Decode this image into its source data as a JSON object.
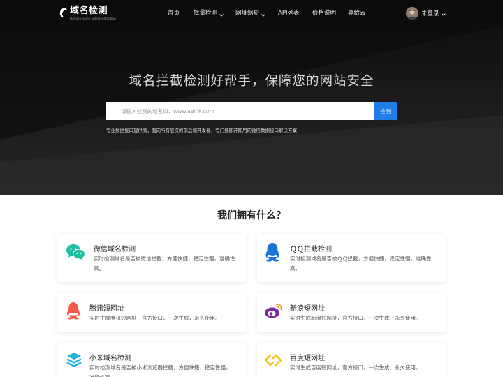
{
  "nav": {
    "logo_title": "域名检测",
    "logo_subtitle": "Domain name Safety Detection",
    "items": [
      {
        "label": "首页"
      },
      {
        "label": "批量检测"
      },
      {
        "label": "网址缩短"
      },
      {
        "label": "API列表"
      },
      {
        "label": "价格说明"
      },
      {
        "label": "尊给云"
      }
    ],
    "user_label": "未登录"
  },
  "hero": {
    "headline": "域名拦截检测好帮手，保障您的网站安全",
    "search_placeholder": "请输入检测的域名如：www.aeink.com",
    "search_button": "检测",
    "description": "专业数据接口提供商，面向所有层次的前后端开发者，专门抵即开即用的微信数据接口解决方案"
  },
  "services": {
    "title": "我们拥有什么？",
    "cards": [
      {
        "title": "微信域名检测",
        "desc": "实时检测域名是否被微信拦截，方便快捷，稳定性强，准确性高。",
        "icon": "wechat-icon",
        "color": "#1dbfa0"
      },
      {
        "title": "ＱＱ拦截检测",
        "desc": "实时检测域名是否被ＱＱ拦截，方便快捷，稳定性强，准确性高。",
        "icon": "qq-icon",
        "color": "#1a73d9"
      },
      {
        "title": "腾讯短网址",
        "desc": "实时生成腾讯短网址，官方接口，一次生成，永久使用。",
        "icon": "tencent-icon",
        "color": "#f25a4a"
      },
      {
        "title": "新浪短网址",
        "desc": "实时生成新浪短网址，官方接口，一次生成，永久使用。",
        "icon": "weibo-icon",
        "color": "#7b2c9b"
      },
      {
        "title": "小米域名检测",
        "desc": "实时检测域名是否被小米浏览器拦截，方便快捷，稳定性强，准确性高。",
        "icon": "layers-icon",
        "color": "#1fb6d6"
      },
      {
        "title": "百度短网址",
        "desc": "实时生成百度短网址，官方接口，一次生成，永久使用。",
        "icon": "link-icon",
        "color": "#f0c419"
      }
    ]
  }
}
